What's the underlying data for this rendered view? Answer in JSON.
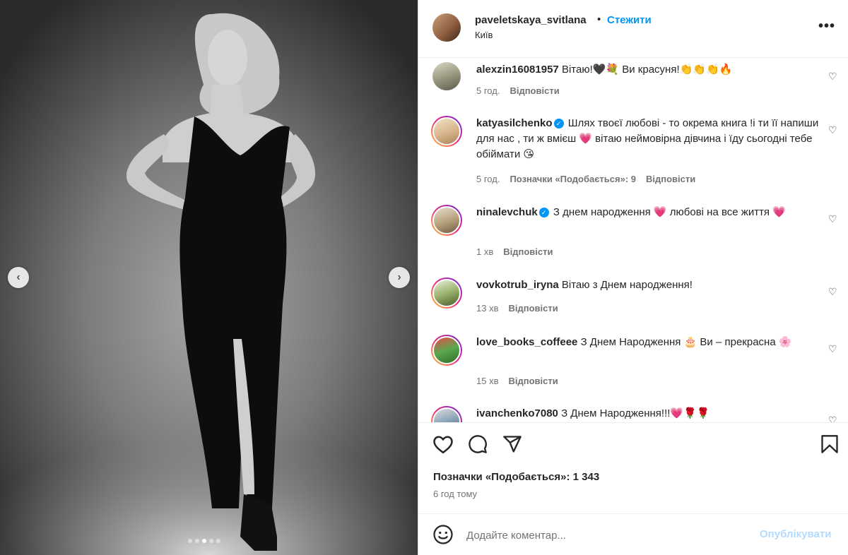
{
  "header": {
    "username": "paveletskaya_svitlana",
    "separator": "•",
    "follow_label": "Стежити",
    "location": "Київ",
    "more_label": "•••"
  },
  "media": {
    "prev_label": "‹",
    "next_label": "›",
    "slide_count": 5,
    "active_slide": 3
  },
  "comments": [
    {
      "username": "alexzin16081957",
      "verified": false,
      "text": "Вітаю!🖤💐 Ви красуня!👏👏👏🔥",
      "time": "5 год.",
      "likes": "",
      "reply": "Відповісти"
    },
    {
      "username": "katyasilchenko",
      "verified": true,
      "text": "Шлях твоєї любові - то окрема книга !і ти її напиши для нас , ти ж вмієш 💗 вітаю неймовірна дівчина і їду сьогодні тебе обіймати 😘",
      "time": "5 год.",
      "likes": "Позначки «Подобається»: 9",
      "reply": "Відповісти"
    },
    {
      "username": "ninalevchuk",
      "verified": true,
      "text": "З днем народження 💗 любові на все життя 💗",
      "time": "1 хв",
      "likes": "",
      "reply": "Відповісти"
    },
    {
      "username": "vovkotrub_iryna",
      "verified": false,
      "text": "Вітаю з Днем народження!",
      "time": "13 хв",
      "likes": "",
      "reply": "Відповісти"
    },
    {
      "username": "love_books_coffeee",
      "verified": false,
      "text": "З Днем Народження 🎂 Ви – прекрасна 🌸",
      "time": "15 хв",
      "likes": "",
      "reply": "Відповісти"
    },
    {
      "username": "ivanchenko7080",
      "verified": false,
      "text": "З Днем Народження!!!💗🌹🌹",
      "time": "",
      "likes": "",
      "reply": ""
    }
  ],
  "actions": {
    "like_icon": "heart-icon",
    "comment_icon": "comment-icon",
    "share_icon": "share-icon",
    "save_icon": "bookmark-icon"
  },
  "likes_text": "Позначки «Подобається»: 1 343",
  "time_ago": "6 год тому",
  "add_comment": {
    "placeholder": "Додайте коментар...",
    "post_label": "Опублікувати"
  },
  "colors": {
    "accent": "#0095f6",
    "post_disabled": "#b3dbff",
    "meta_gray": "#737373"
  }
}
